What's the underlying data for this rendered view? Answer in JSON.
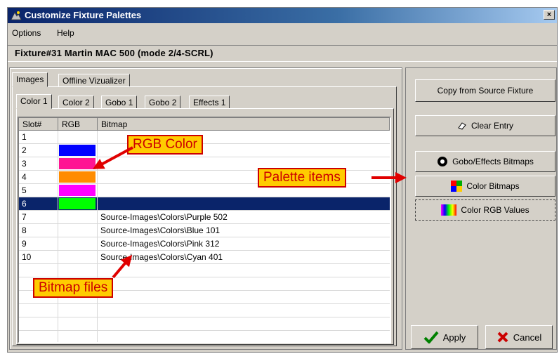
{
  "window": {
    "title": "Customize Fixture Palettes",
    "close_glyph": "×"
  },
  "menu": {
    "options": "Options",
    "help": "Help"
  },
  "fixture": {
    "label": "Fixture#31   Martin MAC 500 (mode 2/4-SCRL)"
  },
  "outer_tabs": [
    "Images",
    "Offline Vizualizer"
  ],
  "inner_tabs": [
    "Color 1",
    "Color 2",
    "Gobo 1",
    "Gobo 2",
    "Effects 1"
  ],
  "table": {
    "headers": [
      "Slot#",
      "RGB",
      "Bitmap"
    ],
    "rows": [
      {
        "slot": "1",
        "rgb": "",
        "bitmap": ""
      },
      {
        "slot": "2",
        "rgb": "#0000ff",
        "bitmap": ""
      },
      {
        "slot": "3",
        "rgb": "#ff1493",
        "bitmap": ""
      },
      {
        "slot": "4",
        "rgb": "#ff8c00",
        "bitmap": ""
      },
      {
        "slot": "5",
        "rgb": "#ff00ff",
        "bitmap": ""
      },
      {
        "slot": "6",
        "rgb": "#00ff00",
        "bitmap": "",
        "selected": true
      },
      {
        "slot": "7",
        "rgb": "",
        "bitmap": "Source-Images\\Colors\\Purple 502"
      },
      {
        "slot": "8",
        "rgb": "",
        "bitmap": "Source-Images\\Colors\\Blue 101"
      },
      {
        "slot": "9",
        "rgb": "",
        "bitmap": "Source-Images\\Colors\\Pink 312"
      },
      {
        "slot": "10",
        "rgb": "",
        "bitmap": "Source-Images\\Colors\\Cyan 401"
      }
    ]
  },
  "buttons": {
    "copy_source": "Copy from Source Fixture",
    "clear_entry": "Clear Entry",
    "gobo_effects": "Gobo/Effects Bitmaps",
    "color_bitmaps": "Color Bitmaps",
    "color_rgb": "Color RGB Values",
    "apply": "Apply",
    "cancel": "Cancel"
  },
  "callouts": {
    "rgb_color": "RGB Color",
    "palette_items": "Palette items",
    "bitmap_files": "Bitmap files"
  },
  "colors": {
    "callout_bg": "#ffcc00",
    "callout_border": "#cc0000",
    "selection": "#0a246a",
    "titlebar": "#0a246a"
  }
}
